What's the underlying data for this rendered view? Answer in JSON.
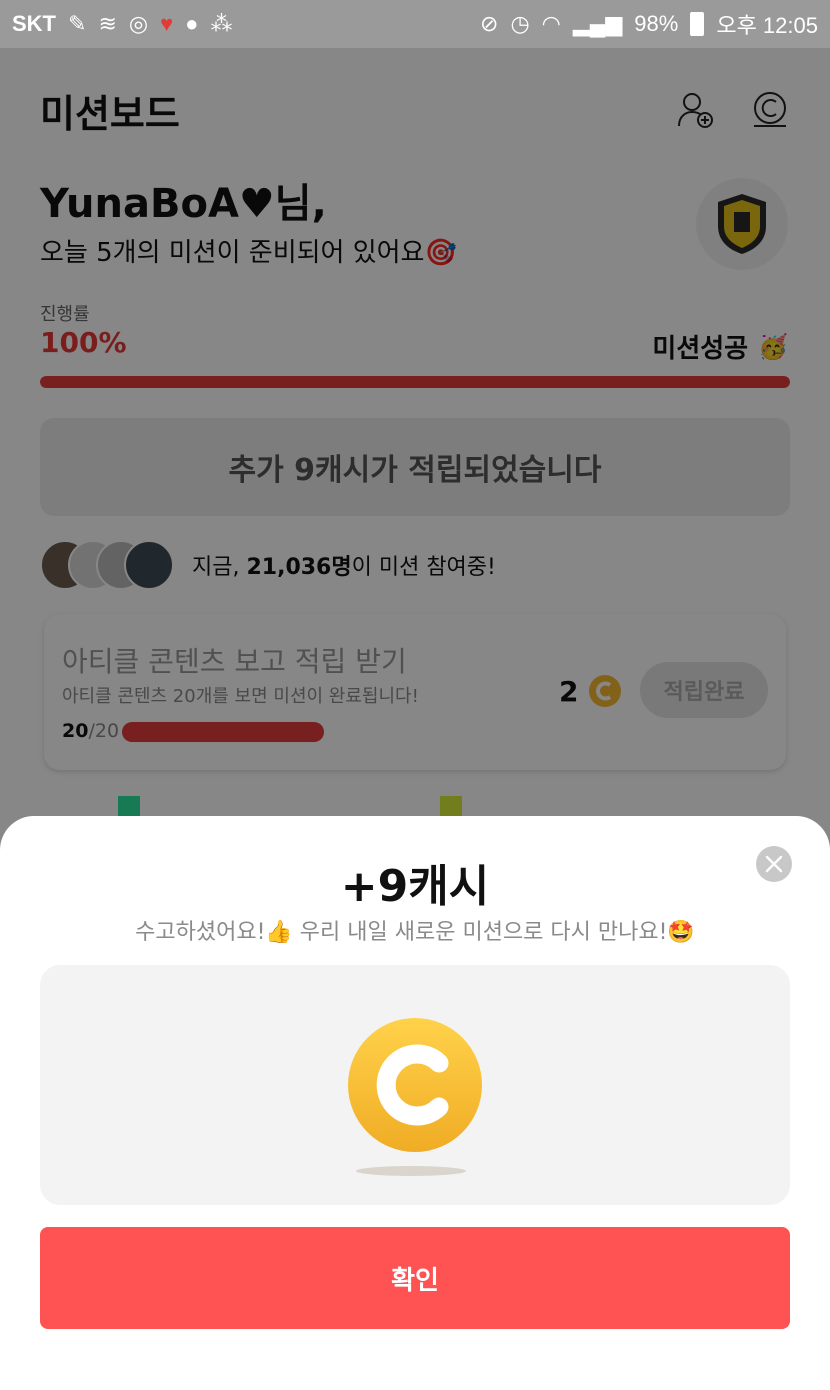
{
  "status_bar": {
    "carrier": "SKT",
    "battery": "98%",
    "time": "오후 12:05",
    "left_icons": [
      "bandage-icon",
      "wave-icon",
      "o-icon",
      "heart-icon",
      "ol-lock-icon",
      "grid-dots-icon"
    ],
    "right_icons": [
      "mute-icon",
      "alarm-icon",
      "wifi-icon",
      "signal-icon",
      "battery-icon"
    ]
  },
  "header": {
    "title": "미션보드",
    "icons": [
      "add-friend-icon",
      "cash-icon"
    ]
  },
  "greeting": {
    "name": "YunaBoA♥님,",
    "subtitle": "오늘 5개의 미션이 준비되어 있어요🎯"
  },
  "progress": {
    "label": "진행률",
    "value_text": "100%",
    "value": 100,
    "status": "미션성공",
    "status_emoji": "🥳"
  },
  "banner": {
    "text": "추가 9캐시가 적립되었습니다"
  },
  "participants": {
    "prefix": "지금, ",
    "count": "21,036명",
    "suffix": "이 미션 참여중!"
  },
  "mission_card": {
    "title": "아티클 콘텐츠 보고 적립 받기",
    "description": "아티클 콘텐츠 20개를 보면 미션이 완료됩니다!",
    "done": "20",
    "total": "/20",
    "progress": 1.0,
    "reward": "2",
    "button": "적립완료"
  },
  "sheet": {
    "title": "+9캐시",
    "subtitle": "수고하셨어요!👍 우리 내일 새로운 미션으로 다시 만나요!🤩",
    "confirm": "확인"
  },
  "colors": {
    "accent": "#ff5252",
    "progress": "#e23b3b",
    "coin": "#f5b82e"
  }
}
